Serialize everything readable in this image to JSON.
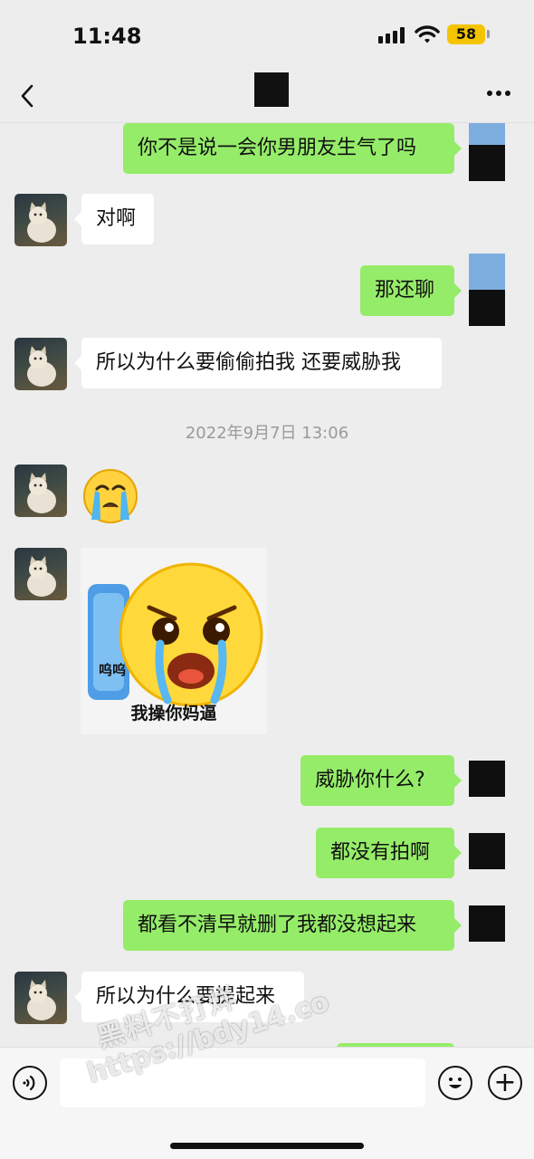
{
  "status_bar": {
    "time": "11:48",
    "battery": "58"
  },
  "nav": {
    "title": ""
  },
  "messages": [
    {
      "side": "right",
      "text": "你不是说一会你男朋友生气了吗"
    },
    {
      "side": "left",
      "text": "对啊"
    },
    {
      "side": "right",
      "text": "那还聊"
    },
    {
      "side": "left",
      "text": "所以为什么要偷偷拍我  还要威胁我"
    },
    {
      "type": "timestamp",
      "text": "2022年9月7日 13:06"
    },
    {
      "side": "left",
      "type": "emoji",
      "icon": "loudly-crying-face-emoji"
    },
    {
      "side": "left",
      "type": "sticker",
      "caption_small": "呜呜",
      "caption": "我操你妈逼"
    },
    {
      "side": "right",
      "text": "威胁你什么?"
    },
    {
      "side": "right",
      "text": "都没有拍啊"
    },
    {
      "side": "right",
      "text": "都看不清早就删了我都没想起来"
    },
    {
      "side": "left",
      "text": "所以为什么要提起来"
    }
  ],
  "input_bar": {
    "placeholder": ""
  },
  "watermark": {
    "line1": "黑料不打烊",
    "line2": "https://bdy14.co"
  },
  "colors": {
    "background": "#ededed",
    "sent_bubble": "#95ec69",
    "received_bubble": "#ffffff",
    "battery": "#f5c400"
  }
}
